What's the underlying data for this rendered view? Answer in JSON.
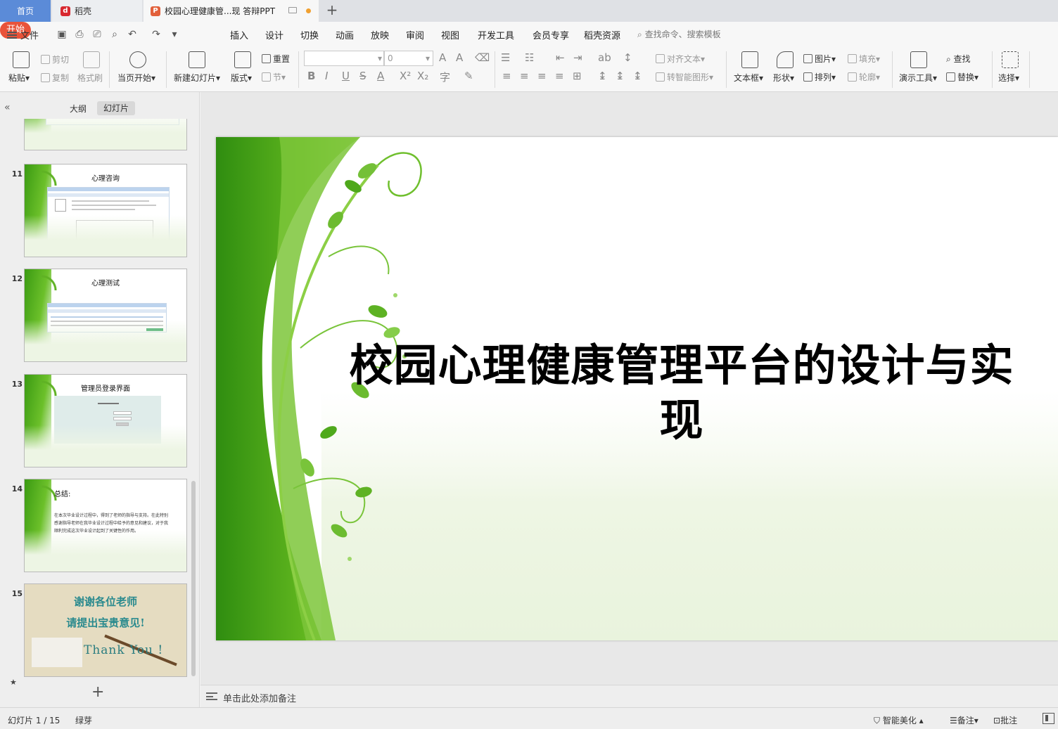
{
  "tabs": {
    "home": "首页",
    "daoke": "稻壳",
    "document": "校园心理健康管...现 答辩PPT"
  },
  "menu": {
    "file": "文件",
    "items": [
      "开始",
      "插入",
      "设计",
      "切换",
      "动画",
      "放映",
      "审阅",
      "视图",
      "开发工具",
      "会员专享",
      "稻壳资源"
    ],
    "search_placeholder": "查找命令、搜索模板"
  },
  "ribbon": {
    "paste": "粘贴",
    "cut": "剪切",
    "copy": "复制",
    "format_painter": "格式刷",
    "from_current": "当页开始",
    "new_slide": "新建幻灯片",
    "layout": "版式",
    "reset": "重置",
    "section": "节",
    "font_name": "",
    "font_size": "0",
    "align_text": "对齐文本",
    "to_smartart": "转智能图形",
    "text_box": "文本框",
    "shape": "形状",
    "picture": "图片",
    "arrange": "排列",
    "fill": "填充",
    "outline": "轮廓",
    "presentation_tools": "演示工具",
    "find": "查找",
    "replace": "替换",
    "select": "选择"
  },
  "left_panel": {
    "outline_tab": "大纲",
    "slides_tab": "幻灯片",
    "thumbnails": [
      {
        "number": "11",
        "title": "心理咨询"
      },
      {
        "number": "12",
        "title": "心理测试"
      },
      {
        "number": "13",
        "title": "管理员登录界面"
      },
      {
        "number": "14",
        "heading": "总结:",
        "body": "在本次毕业设计过程中，得到了老师的指导与支持。在此特别感谢指导老师在我毕业设计过程中给予的意见和建议，对于我顺利完成这次毕业设计起到了关键性的作用。"
      },
      {
        "number": "15",
        "line1": "谢谢各位老师",
        "line2": "请提出宝贵意见!",
        "line3": "Thank You !"
      }
    ]
  },
  "slide": {
    "title": "校园心理健康管理平台的设计与实现"
  },
  "notes": {
    "placeholder": "单击此处添加备注"
  },
  "status": {
    "slide_counter": "幻灯片 1 / 15",
    "theme": "绿芽",
    "beautify": "智能美化",
    "notes": "备注",
    "comments": "批注"
  }
}
